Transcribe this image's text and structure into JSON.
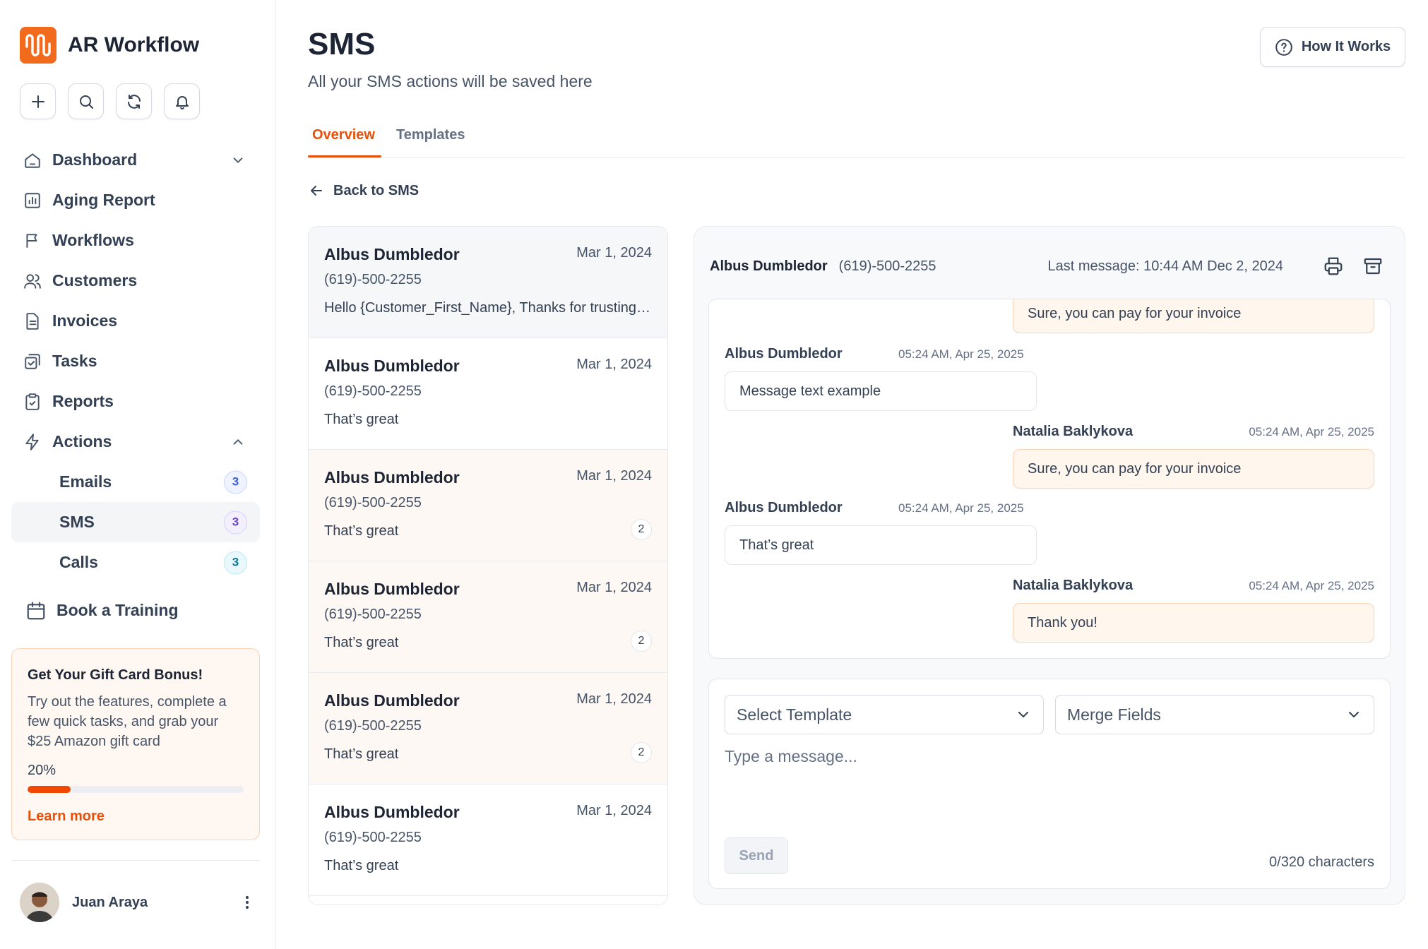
{
  "brand": {
    "name": "AR Workflow"
  },
  "nav": {
    "dashboard": "Dashboard",
    "aging": "Aging Report",
    "workflows": "Workflows",
    "customers": "Customers",
    "invoices": "Invoices",
    "tasks": "Tasks",
    "reports": "Reports",
    "actions": "Actions",
    "sub": [
      {
        "label": "Emails",
        "count": "3"
      },
      {
        "label": "SMS",
        "count": "3"
      },
      {
        "label": "Calls",
        "count": "3"
      }
    ],
    "training": "Book a Training"
  },
  "gift": {
    "title": "Get Your Gift Card Bonus!",
    "body": "Try out the features, complete a few quick tasks, and grab your $25 Amazon gift card",
    "percent": "20%",
    "progress": 0.2,
    "link": "Learn more"
  },
  "user": {
    "name": "Juan Araya"
  },
  "header": {
    "title": "SMS",
    "subtitle": "All your SMS actions will be saved here",
    "how_it_works": "How It Works"
  },
  "tabs": [
    "Overview",
    "Templates"
  ],
  "back": "Back to SMS",
  "conversations": [
    {
      "name": "Albus Dumbledor",
      "date": "Mar 1, 2024",
      "phone": "(619)-500-2255",
      "message": "Hello {Customer_First_Name}, Thanks for trusting us",
      "badge": ""
    },
    {
      "name": "Albus Dumbledor",
      "date": "Mar 1, 2024",
      "phone": "(619)-500-2255",
      "message": "That’s great",
      "badge": ""
    },
    {
      "name": "Albus Dumbledor",
      "date": "Mar 1, 2024",
      "phone": "(619)-500-2255",
      "message": "That’s great",
      "badge": "2"
    },
    {
      "name": "Albus Dumbledor",
      "date": "Mar 1, 2024",
      "phone": "(619)-500-2255",
      "message": "That’s great",
      "badge": "2"
    },
    {
      "name": "Albus Dumbledor",
      "date": "Mar 1, 2024",
      "phone": "(619)-500-2255",
      "message": "That’s great",
      "badge": "2"
    },
    {
      "name": "Albus Dumbledor",
      "date": "Mar 1, 2024",
      "phone": "(619)-500-2255",
      "message": "That’s great",
      "badge": ""
    }
  ],
  "chat": {
    "name": "Albus Dumbledor",
    "phone": "(619)-500-2255",
    "last_message": "Last message: 10:44 AM Dec 2, 2024",
    "messages": [
      {
        "text": "Sure, you can pay for your invoice"
      },
      {
        "sender": "Albus Dumbledor",
        "time": "05:24 AM, Apr 25, 2025",
        "text": "Message text example"
      },
      {
        "sender": "Natalia Baklykova",
        "time": "05:24 AM, Apr 25, 2025",
        "text": "Sure, you can pay for your invoice"
      },
      {
        "sender": "Albus Dumbledor",
        "time": "05:24 AM, Apr 25, 2025",
        "text": "That’s great"
      },
      {
        "sender": "Natalia Baklykova",
        "time": "05:24 AM, Apr 25, 2025",
        "text": "Thank you!"
      }
    ]
  },
  "composer": {
    "template_placeholder": "Select Template",
    "merge_placeholder": "Merge Fields",
    "message_placeholder": "Type a message...",
    "send": "Send",
    "char_count": "0/320 characters"
  },
  "colors": {
    "accent": "#e8500a",
    "brand": "#f26b1d",
    "progress": "#f04a00"
  }
}
